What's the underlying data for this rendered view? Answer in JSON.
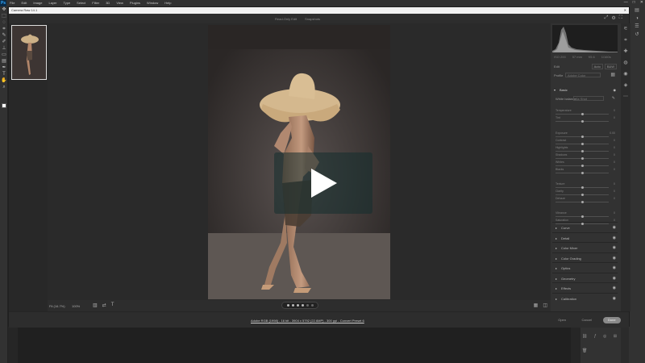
{
  "menubar": {
    "logo": "Ps",
    "items": [
      "File",
      "Edit",
      "Image",
      "Layer",
      "Type",
      "Select",
      "Filter",
      "3D",
      "View",
      "Plugins",
      "Window",
      "Help"
    ],
    "window_controls": [
      "—",
      "□",
      "✕"
    ]
  },
  "dialog": {
    "title": "Camera Raw 14.1",
    "header_tabs": [
      "Read-Only Edit",
      "Snapshots"
    ]
  },
  "preview": {
    "zoom_label": "Fit (16.7%)",
    "zoom_value": "100%"
  },
  "panel": {
    "readout": [
      "ISO 200",
      "57 mm",
      "f/5.6",
      "1/160s"
    ],
    "profile_label": "Edit",
    "edit_buttons": [
      "Auto",
      "B&W"
    ],
    "profile": {
      "label": "Profile",
      "value": "Adobe Color"
    },
    "basic": {
      "title": "Basic",
      "white_balance": {
        "label": "White balance",
        "value": "As Shot"
      },
      "sliders": [
        {
          "name": "Temperature",
          "value": "0",
          "pos": 0.5
        },
        {
          "name": "Tint",
          "value": "0",
          "pos": 0.5
        },
        {
          "name": "Exposure",
          "value": "0.00",
          "pos": 0.5
        },
        {
          "name": "Contrast",
          "value": "0",
          "pos": 0.5
        },
        {
          "name": "Highlights",
          "value": "0",
          "pos": 0.5
        },
        {
          "name": "Shadows",
          "value": "0",
          "pos": 0.5
        },
        {
          "name": "Whites",
          "value": "0",
          "pos": 0.5
        },
        {
          "name": "Blacks",
          "value": "0",
          "pos": 0.5
        },
        {
          "name": "Texture",
          "value": "0",
          "pos": 0.5
        },
        {
          "name": "Clarity",
          "value": "0",
          "pos": 0.5
        },
        {
          "name": "Dehaze",
          "value": "0",
          "pos": 0.5
        },
        {
          "name": "Vibrance",
          "value": "0",
          "pos": 0.5
        },
        {
          "name": "Saturation",
          "value": "0",
          "pos": 0.5
        }
      ]
    },
    "sections": [
      "Curve",
      "Detail",
      "Color Mixer",
      "Color Grading",
      "Optics",
      "Geometry",
      "Effects",
      "Calibration"
    ]
  },
  "footer": {
    "info": "Adobe RGB (1998) - 16 bit - 3904 x 5792 (22.6MP) - 300 ppi - Convert Preset 6",
    "open_label": "Open",
    "cancel_label": "Cancel",
    "done_label": "Done"
  },
  "video": {
    "play_label": "Play"
  }
}
